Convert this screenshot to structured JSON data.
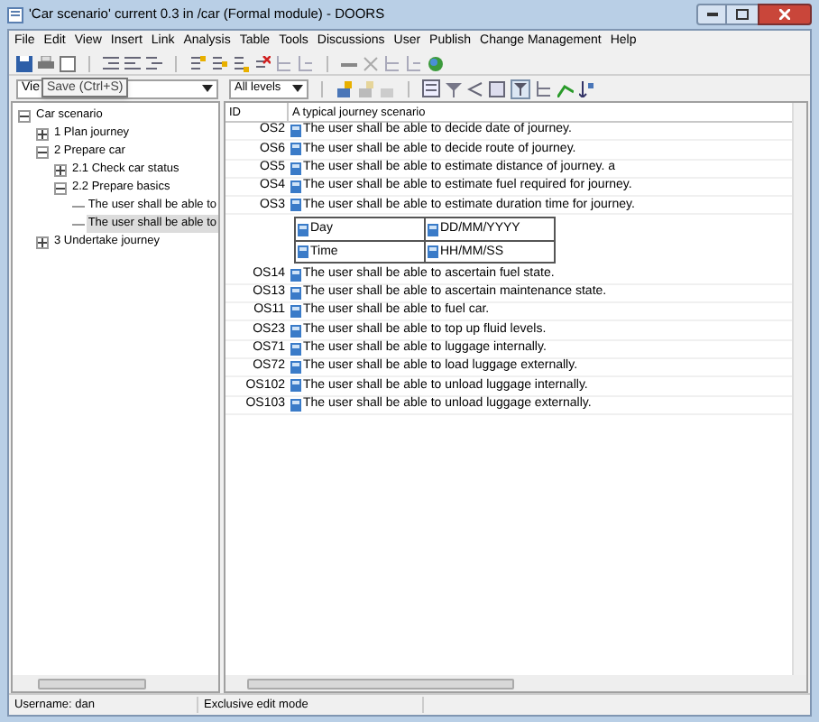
{
  "window": {
    "title": "'Car scenario' current 0.3 in /car (Formal module) - DOORS"
  },
  "menu": [
    "File",
    "Edit",
    "View",
    "Insert",
    "Link",
    "Analysis",
    "Table",
    "Tools",
    "Discussions",
    "User",
    "Publish",
    "Change Management",
    "Help"
  ],
  "toolbar": {
    "view_dropdown": "Vie",
    "level_dropdown": "All levels",
    "tooltip": "Save (Ctrl+S)"
  },
  "tree": [
    {
      "kind": "section",
      "label": "Car scenario",
      "expanded": true,
      "children": [
        {
          "kind": "section",
          "label": "1 Plan journey",
          "expanded": false
        },
        {
          "kind": "section",
          "label": "2 Prepare car",
          "expanded": true,
          "children": [
            {
              "kind": "section",
              "label": "2.1 Check car status",
              "expanded": false
            },
            {
              "kind": "section",
              "label": "2.2 Prepare basics",
              "expanded": true,
              "children": [
                {
                  "kind": "object",
                  "label": "The user shall be able to",
                  "selected": false
                },
                {
                  "kind": "object",
                  "label": "The user shall be able to",
                  "selected": true
                }
              ]
            }
          ]
        },
        {
          "kind": "section",
          "label": "3 Undertake journey",
          "expanded": false
        }
      ]
    }
  ],
  "table": {
    "columns": [
      "ID",
      "A typical journey scenario"
    ],
    "rows": [
      {
        "kind": "object",
        "id": "OS2",
        "text": "The user shall be able to decide date of journey."
      },
      {
        "kind": "object",
        "id": "OS6",
        "text": "The user shall be able to decide route of journey."
      },
      {
        "kind": "object",
        "id": "OS5",
        "text": "The user shall be able to estimate distance of journey. a"
      },
      {
        "kind": "object",
        "id": "OS4",
        "text": "The user shall be able to estimate fuel required for journey."
      },
      {
        "kind": "object",
        "id": "OS3",
        "text": "The user shall be able to estimate duration time for journey."
      },
      {
        "kind": "table",
        "cells": [
          [
            "Day",
            "DD/MM/YYYY"
          ],
          [
            "Time",
            "HH/MM/SS"
          ]
        ]
      },
      {
        "kind": "object",
        "id": "OS14",
        "text": "The user shall be able to ascertain fuel state."
      },
      {
        "kind": "object",
        "id": "OS13",
        "text": "The user shall be able to ascertain maintenance state."
      },
      {
        "kind": "object",
        "id": "OS11",
        "text": "The user shall be able to fuel car."
      },
      {
        "kind": "object",
        "id": "OS23",
        "text": "The user shall be able to top up fluid levels."
      },
      {
        "kind": "object",
        "id": "OS71",
        "text": "The user shall be able to luggage internally."
      },
      {
        "kind": "object",
        "id": "OS72",
        "text": "The user shall be able to load luggage externally."
      },
      {
        "kind": "object",
        "id": "OS102",
        "text": "The user shall be able to unload luggage internally."
      },
      {
        "kind": "object",
        "id": "OS103",
        "text": "The user shall be able to unload luggage externally."
      }
    ]
  },
  "status_bar": [
    "Username: dan",
    "Exclusive edit mode"
  ]
}
